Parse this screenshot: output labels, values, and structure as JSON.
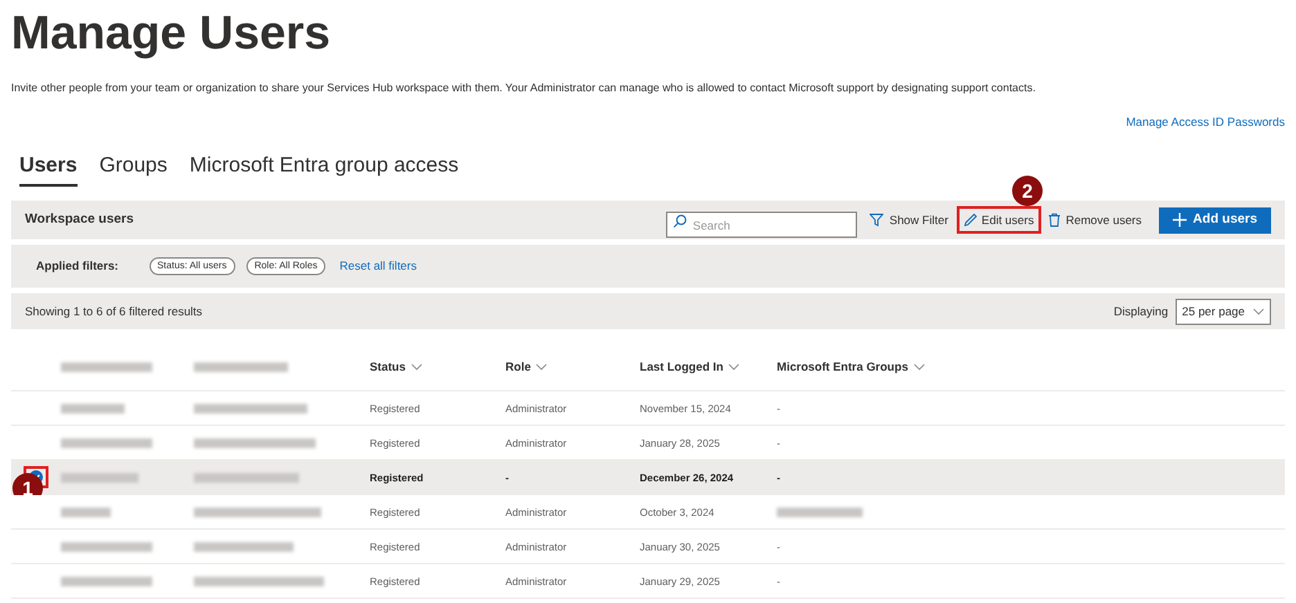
{
  "page": {
    "title": "Manage Users",
    "description": "Invite other people from your team or organization to share your Services Hub workspace with them. Your Administrator can manage who is allowed to contact Microsoft support by designating support contacts.",
    "link": "Manage Access ID Passwords"
  },
  "tabs": [
    {
      "label": "Users",
      "selected": true
    },
    {
      "label": "Groups",
      "selected": false
    },
    {
      "label": "Microsoft Entra group access",
      "selected": false
    }
  ],
  "toolbar": {
    "title": "Workspace users",
    "search": {
      "placeholder": "Search"
    },
    "show_filter": "Show Filter",
    "edit_users": "Edit users",
    "remove_users": "Remove users",
    "add_users": "Add users",
    "callout": "2"
  },
  "filters": {
    "label": "Applied filters:",
    "chips": [
      "Status: All users",
      "Role: All Roles"
    ],
    "reset": "Reset all filters"
  },
  "results": {
    "summary": "Showing 1 to 6 of 6 filtered results",
    "displaying_label": "Displaying",
    "page_size": "25 per page"
  },
  "table": {
    "columns": [
      {
        "label": "Status"
      },
      {
        "label": "Role"
      },
      {
        "label": "Last Logged In"
      },
      {
        "label": "Microsoft Entra Groups"
      }
    ],
    "rows": [
      {
        "selected": false,
        "status": "Registered",
        "role": "Administrator",
        "last_logged_in": "November 15, 2024",
        "groups": "-"
      },
      {
        "selected": false,
        "status": "Registered",
        "role": "Administrator",
        "last_logged_in": "January 28, 2025",
        "groups": "-"
      },
      {
        "selected": true,
        "status": "Registered",
        "role": "-",
        "last_logged_in": "December 26, 2024",
        "groups": "-",
        "callout": "1"
      },
      {
        "selected": false,
        "status": "Registered",
        "role": "Administrator",
        "last_logged_in": "October 3, 2024",
        "groups_redacted": true
      },
      {
        "selected": false,
        "status": "Registered",
        "role": "Administrator",
        "last_logged_in": "January 30, 2025",
        "groups": "-"
      },
      {
        "selected": false,
        "status": "Registered",
        "role": "Administrator",
        "last_logged_in": "January 29, 2025",
        "groups": "-"
      }
    ]
  }
}
